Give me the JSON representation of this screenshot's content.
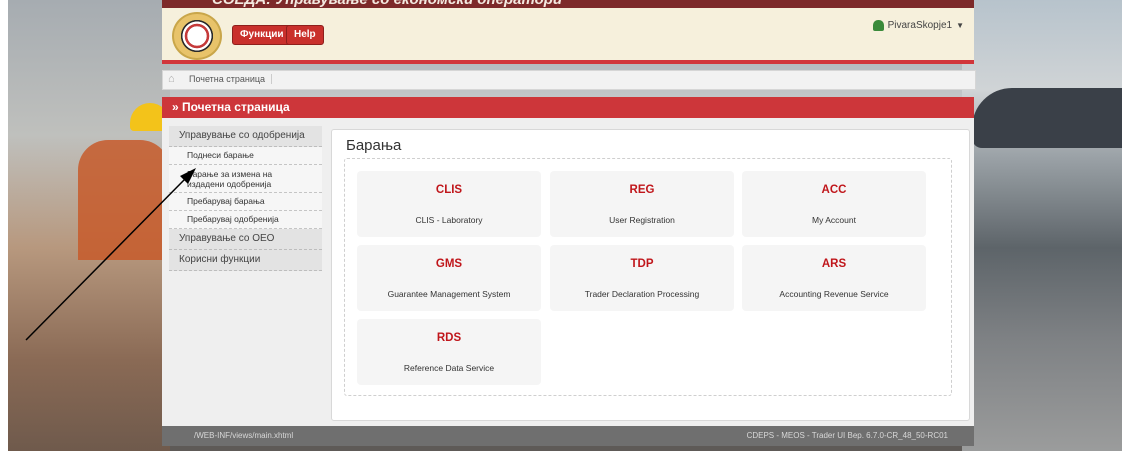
{
  "window": {
    "title": "СОЕДА: Управување со економски оператори"
  },
  "header": {
    "functions_label": "Функции",
    "help_label": "Help",
    "user_name": "PivaraSkopje1"
  },
  "breadcrumb": {
    "current": "Почетна страница"
  },
  "page_title": "» Почетна страница",
  "sidebar": {
    "groups": [
      {
        "label": "Управување со одобренија"
      },
      {
        "label": "Управување со OEO"
      },
      {
        "label": "Корисни функции"
      }
    ],
    "items": [
      {
        "label": "Поднеси барање"
      },
      {
        "label_line1": "Барање за измена на",
        "label_line2": "издадени одобренија"
      },
      {
        "label": "Пребарувај барања"
      },
      {
        "label": "Пребарувај одобренија"
      }
    ]
  },
  "content": {
    "title": "Барања",
    "tiles": [
      {
        "code": "CLIS",
        "name": "CLIS - Laboratory"
      },
      {
        "code": "REG",
        "name": "User Registration"
      },
      {
        "code": "ACC",
        "name": "My Account"
      },
      {
        "code": "GMS",
        "name": "Guarantee Management System"
      },
      {
        "code": "TDP",
        "name": "Trader Declaration Processing"
      },
      {
        "code": "ARS",
        "name": "Accounting Revenue Service"
      },
      {
        "code": "RDS",
        "name": "Reference Data Service"
      }
    ]
  },
  "footer": {
    "left": "/WEB-INF/views/main.xhtml",
    "right": "CDEPS - MEOS - Trader UI Вер. 6.7.0-CR_48_50-RC01"
  },
  "colors": {
    "accent": "#cd363a",
    "tile_code": "#c0161b"
  },
  "icons": {
    "user": "user-icon",
    "home": "home-icon",
    "dropdown": "chevron-down-icon",
    "arrow": "annotation-arrow"
  }
}
